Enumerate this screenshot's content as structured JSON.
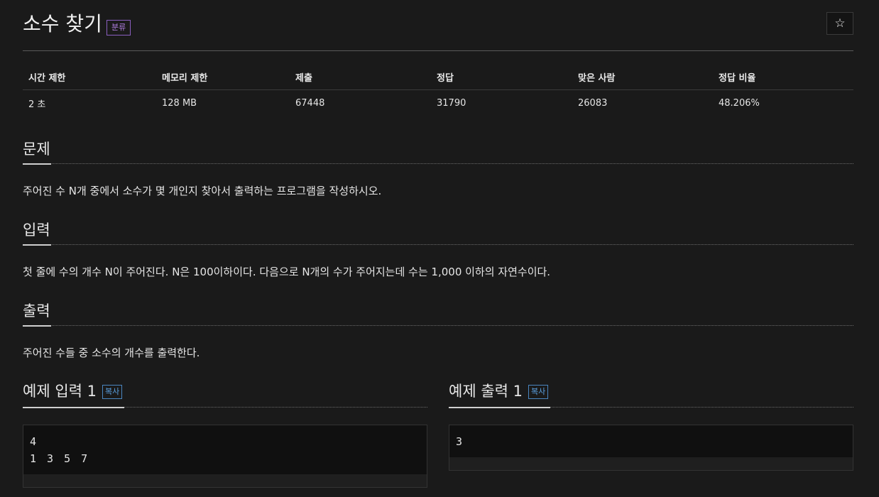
{
  "problem": {
    "title": "소수 찾기",
    "category_badge": "분류",
    "star_icon": "☆"
  },
  "stats": {
    "headers": [
      "시간 제한",
      "메모리 제한",
      "제출",
      "정답",
      "맞은 사람",
      "정답 비율"
    ],
    "values": [
      "2 초",
      "128 MB",
      "67448",
      "31790",
      "26083",
      "48.206%"
    ]
  },
  "sections": {
    "description": {
      "title": "문제",
      "body": "주어진 수 N개 중에서 소수가 몇 개인지 찾아서 출력하는 프로그램을 작성하시오."
    },
    "input": {
      "title": "입력",
      "body": "첫 줄에 수의 개수 N이 주어진다. N은 100이하이다. 다음으로 N개의 수가 주어지는데 수는 1,000 이하의 자연수이다."
    },
    "output": {
      "title": "출력",
      "body": "주어진 수들 중 소수의 개수를 출력한다."
    }
  },
  "samples": {
    "input": {
      "title": "예제 입력 1",
      "copy_label": "복사",
      "lines": [
        "4",
        "1 3 5 7"
      ]
    },
    "output": {
      "title": "예제 출력 1",
      "copy_label": "복사",
      "lines": [
        "3"
      ]
    }
  },
  "colors": {
    "category_badge": "#b07ee0",
    "copy_button": "#5aa0e0",
    "background": "#1a1a1a"
  }
}
